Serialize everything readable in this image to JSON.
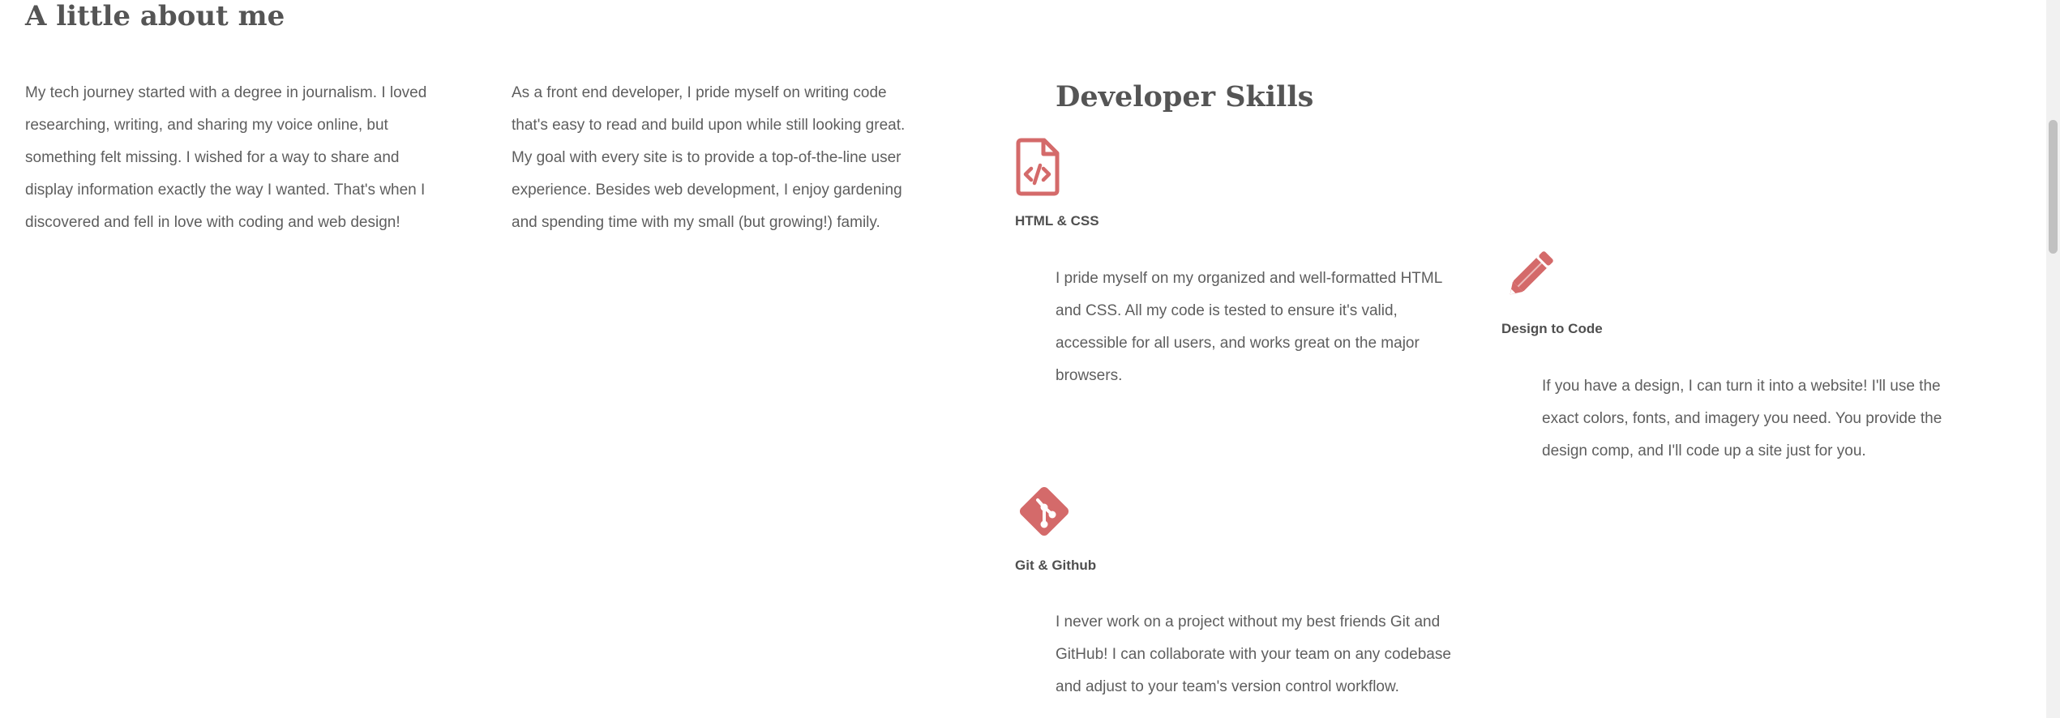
{
  "about": {
    "title": "A little about me",
    "paragraph_1": "My tech journey started with a degree in journalism. I loved researching, writing, and sharing my voice online, but something felt missing. I wished for a way to share and display information exactly the way I wanted. That's when I discovered and fell in love with coding and web design!",
    "paragraph_2": "As a front end developer, I pride myself on writing code that's easy to read and build upon while still looking great. My goal with every site is to provide a top-of-the-line user experience. Besides web development, I enjoy gardening and spending time with my small (but growing!) family."
  },
  "skills": {
    "title": "Developer Skills",
    "accent_color": "#d46a6a",
    "items": [
      {
        "icon": "file-code-icon",
        "name": "HTML & CSS",
        "description": "I pride myself on my organized and well-formatted HTML and CSS. All my code is tested to ensure it's valid, accessible for all users, and works great on the major browsers."
      },
      {
        "icon": "pencil-icon",
        "name": "Design to Code",
        "description": "If you have a design, I can turn it into a website! I'll use the exact colors, fonts, and imagery you need. You provide the design comp, and I'll code up a site just for you."
      },
      {
        "icon": "git-icon",
        "name": "Git & Github",
        "description": "I never work on a project without my best friends Git and GitHub! I can collaborate with your team on any codebase and adjust to your team's version control workflow."
      }
    ]
  }
}
